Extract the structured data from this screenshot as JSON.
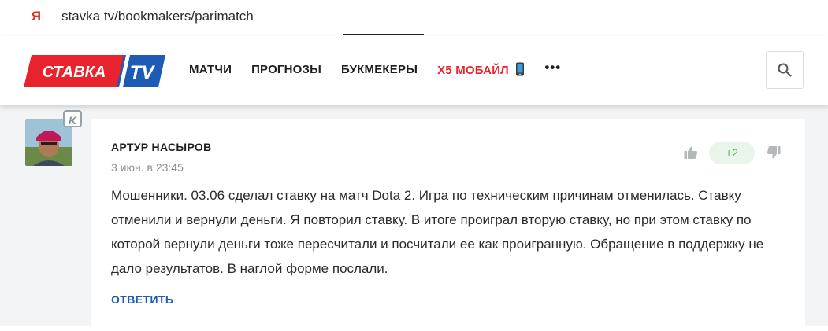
{
  "browser": {
    "url": "stavka tv/bookmakers/parimatch",
    "yandex_glyph": "Я"
  },
  "header": {
    "logo": {
      "left": "СТАВКА",
      "right": "TV",
      "left_color": "#e8232e",
      "right_color": "#1d5bb5"
    },
    "nav": [
      {
        "label": "МАТЧИ"
      },
      {
        "label": "ПРОГНОЗЫ"
      },
      {
        "label": "БУКМЕКЕРЫ"
      },
      {
        "label": "X5 МОБАЙЛ",
        "accent": true
      }
    ],
    "more": "•••",
    "search_icon": "search-icon"
  },
  "comment": {
    "badge": "K",
    "author": "АРТУР НАСЫРОВ",
    "time": "3 июн. в 23:45",
    "text": "Мошенники. 03.06 сделал ставку на матч Dota 2. Игра по техническим причинам отменилась. Ставку отменили и вернули деньги. Я повторил ставку. В итоге проиграл вторую ставку, но при этом ставку по которой вернули деньги тоже пересчитали и посчитали ее как проигранную. Обращение в поддержку не дало результатов. В наглой форме послали.",
    "score": "+2",
    "reply_label": "ОТВЕТИТЬ"
  },
  "colors": {
    "accent_red": "#e8232e",
    "accent_blue": "#1d5bb5",
    "vote_green": "#4caf50",
    "page_bg": "#f3f4f6"
  }
}
